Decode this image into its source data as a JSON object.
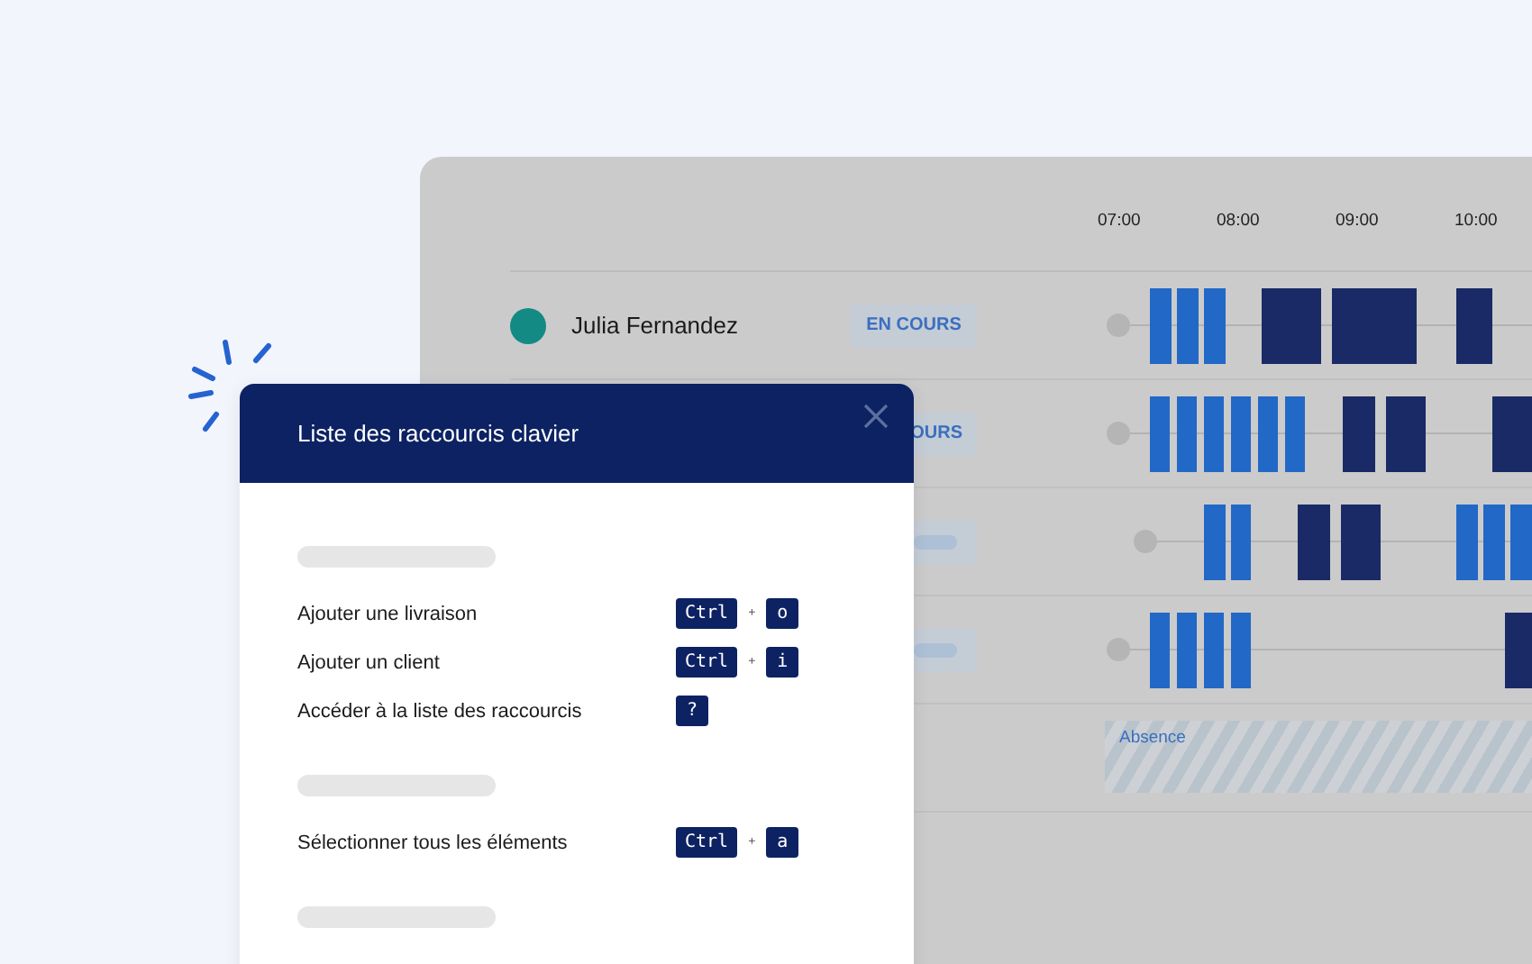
{
  "schedule": {
    "hours": [
      "07:00",
      "08:00",
      "09:00",
      "10:00"
    ],
    "rows": [
      {
        "kind": "person",
        "name": "Julia Fernandez",
        "status": "EN COURS"
      },
      {
        "kind": "partial",
        "status": "OURS"
      },
      {
        "kind": "placeholder"
      },
      {
        "kind": "placeholder"
      },
      {
        "kind": "absence",
        "label": "Absence"
      }
    ]
  },
  "dialog": {
    "title": "Liste des raccourcis clavier",
    "sections": [
      {
        "kind": "section",
        "shortcuts": [
          {
            "label": "Ajouter une livraison",
            "keys": [
              {
                "kind": "key",
                "text": "Ctrl"
              },
              {
                "kind": "plus",
                "text": "+"
              },
              {
                "kind": "key",
                "text": "o"
              }
            ]
          },
          {
            "label": "Ajouter un client",
            "keys": [
              {
                "kind": "key",
                "text": "Ctrl"
              },
              {
                "kind": "plus",
                "text": "+"
              },
              {
                "kind": "key",
                "text": "i"
              }
            ]
          },
          {
            "label": "Accéder à la liste des raccourcis",
            "keys": [
              {
                "kind": "key",
                "text": "?"
              }
            ]
          }
        ]
      },
      {
        "kind": "section",
        "shortcuts": [
          {
            "label": "Sélectionner tous les éléments",
            "keys": [
              {
                "kind": "key",
                "text": "Ctrl"
              },
              {
                "kind": "plus",
                "text": "+"
              },
              {
                "kind": "key",
                "text": "a"
              }
            ]
          }
        ]
      },
      {
        "kind": "section"
      }
    ]
  }
}
